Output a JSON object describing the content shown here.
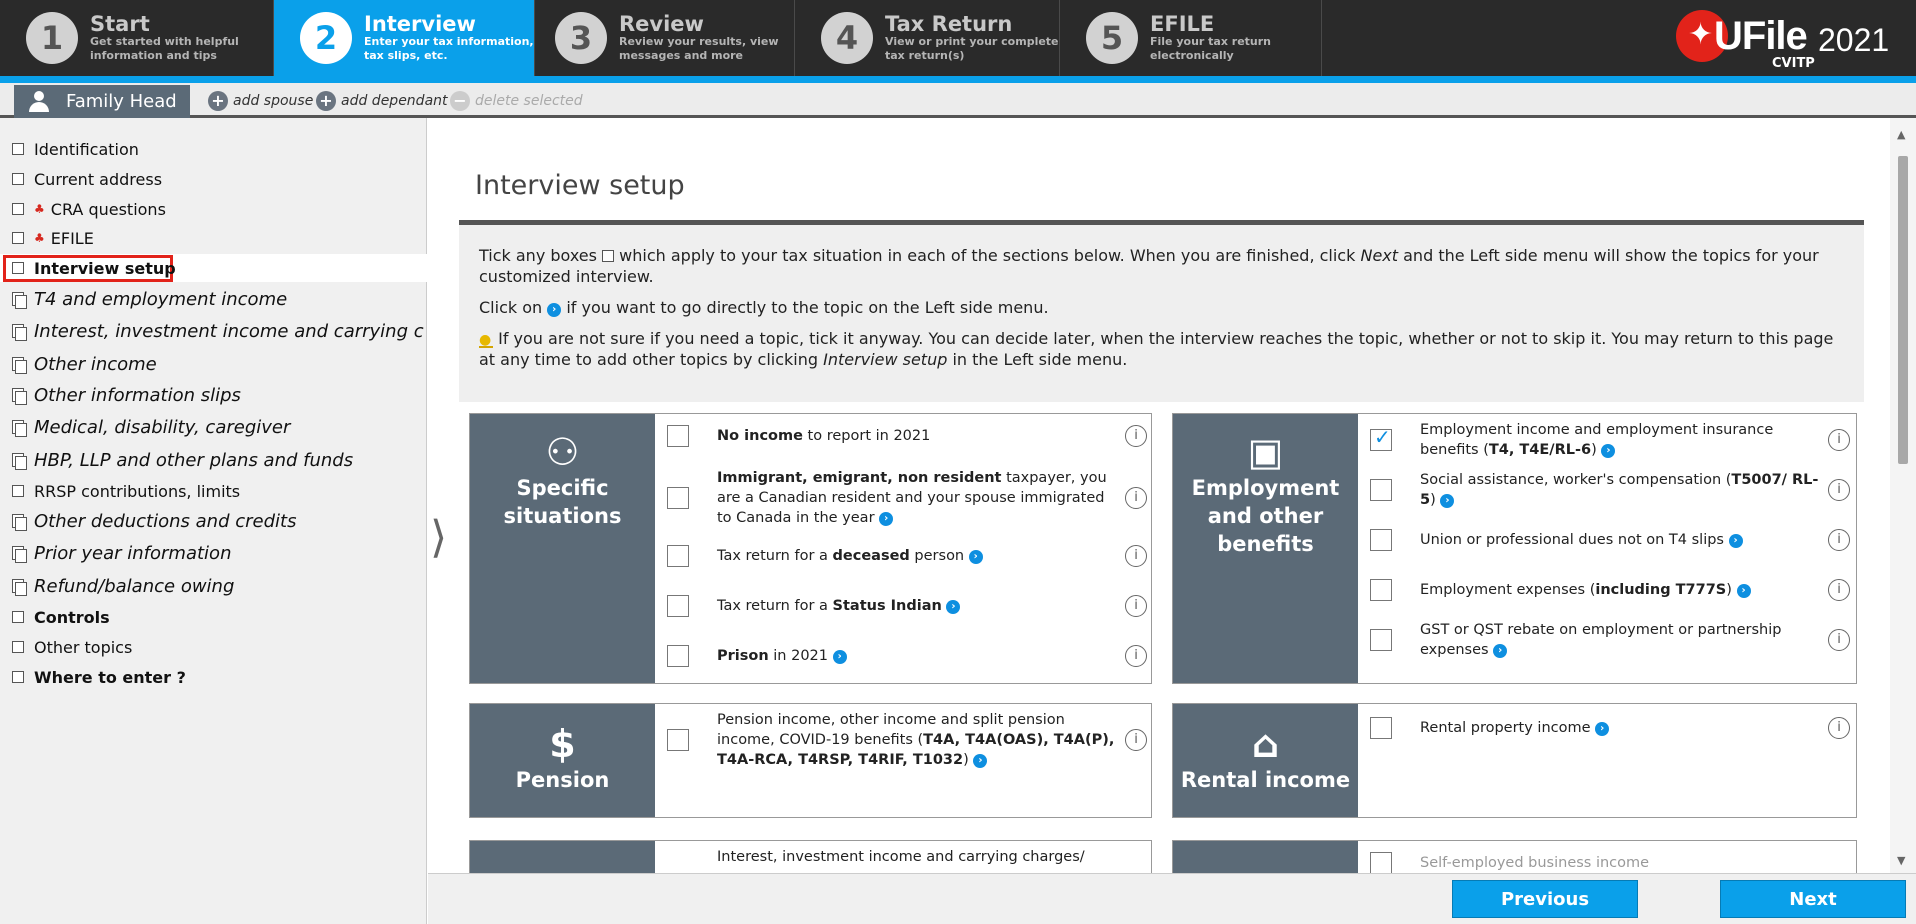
{
  "steps": [
    {
      "num": "1",
      "title": "Start",
      "sub1": "Get started with helpful",
      "sub2": "information and tips"
    },
    {
      "num": "2",
      "title": "Interview",
      "sub1": "Enter your tax information,",
      "sub2": "tax slips, etc."
    },
    {
      "num": "3",
      "title": "Review",
      "sub1": "Review your results, view",
      "sub2": "messages and more"
    },
    {
      "num": "4",
      "title": "Tax Return",
      "sub1": "View or print your complete",
      "sub2": "tax return(s)"
    },
    {
      "num": "5",
      "title": "EFILE",
      "sub1": "File your tax return",
      "sub2": "electronically"
    }
  ],
  "logo": {
    "brand": "UFile",
    "year": "2021",
    "edition": "CVITP"
  },
  "family": {
    "tab": "Family Head",
    "add_spouse": "add spouse",
    "add_dependant": "add dependant",
    "delete_selected": "delete selected"
  },
  "sidebar": {
    "items": [
      {
        "label": "Identification"
      },
      {
        "label": "Current address"
      },
      {
        "label": "CRA questions"
      },
      {
        "label": "EFILE"
      },
      {
        "label": "Interview setup"
      },
      {
        "label": "T4 and employment income"
      },
      {
        "label": "Interest, investment income and carrying charges"
      },
      {
        "label": "Other income"
      },
      {
        "label": "Other information slips"
      },
      {
        "label": "Medical, disability, caregiver"
      },
      {
        "label": "HBP, LLP and other plans and funds"
      },
      {
        "label": "RRSP contributions, limits"
      },
      {
        "label": "Other deductions and credits"
      },
      {
        "label": "Prior year information"
      },
      {
        "label": "Refund/balance owing"
      },
      {
        "label": "Controls"
      },
      {
        "label": "Other topics"
      },
      {
        "label": "Where to enter ?"
      }
    ]
  },
  "main": {
    "title": "Interview setup",
    "intro1a": "Tick any boxes",
    "intro1b": "which apply to your tax situation in each of the sections below. When you are finished, click",
    "intro1c": "Next",
    "intro1d": "and the Left side menu will show the topics for your customized interview.",
    "intro2a": "Click on",
    "intro2b": "if you want to go directly to the topic on the Left side menu.",
    "intro3a": "If you are not sure if you need a topic, tick it anyway. You can decide later, when the interview reaches the topic, whether or not to skip it. You may return to this page at any time to add other topics by clicking",
    "intro3b": "Interview setup",
    "intro3c": "in the Left side menu."
  },
  "cards": {
    "specific": {
      "l1": "Specific",
      "l2": "situations",
      "rows": [
        {
          "bold": "No income",
          "rest": " to report in 2021"
        },
        {
          "bold": "Immigrant, emigrant, non resident",
          "rest": " taxpayer, you are a Canadian resident and your spouse immigrated to Canada in the year"
        },
        {
          "pre": "Tax return for a ",
          "bold": "deceased",
          "rest": " person"
        },
        {
          "pre": "Tax return for a ",
          "bold": "Status Indian",
          "rest": ""
        },
        {
          "bold": "Prison",
          "rest": " in 2021"
        }
      ]
    },
    "employment": {
      "l1": "Employment",
      "l2": "and other",
      "l3": "benefits",
      "rows": [
        {
          "pre": "Employment income and employment insurance benefits (",
          "bold": "T4, T4E/RL-6",
          "rest": ")",
          "checked": true
        },
        {
          "pre": "Social assistance, worker's compensation (",
          "bold": "T5007/ RL-5",
          "rest": ")"
        },
        {
          "pre": "Union or professional dues not on T4 slips",
          "bold": "",
          "rest": ""
        },
        {
          "pre": "Employment expenses (",
          "bold": "including T777S",
          "rest": ")"
        },
        {
          "pre": "GST or QST rebate on employment or partnership expenses",
          "bold": "",
          "rest": ""
        }
      ]
    },
    "pension": {
      "l1": "Pension",
      "row": {
        "pre": "Pension income, other income and split pension income, COVID-19 benefits (",
        "bold": "T4A, T4A(OAS), T4A(P), T4A-RCA, T4RSP, T4RIF, T1032",
        "rest": ")"
      }
    },
    "rental": {
      "l1": "Rental income",
      "row": {
        "pre": "Rental property income"
      }
    },
    "interest": {
      "row": {
        "pre": "Interest, investment income and carrying charges/"
      }
    },
    "self": {
      "row": {
        "pre": "Self-employed business income"
      }
    }
  },
  "buttons": {
    "previous": "Previous",
    "next": "Next"
  }
}
